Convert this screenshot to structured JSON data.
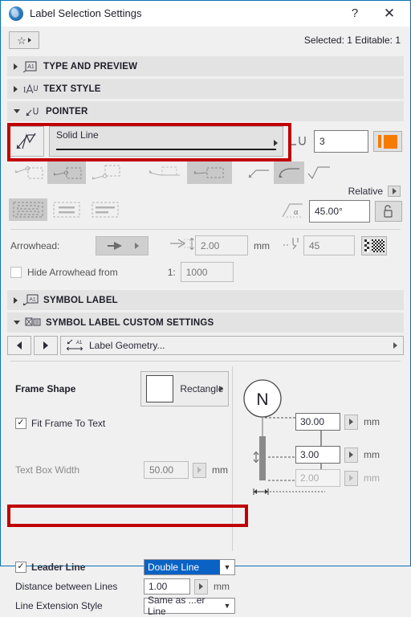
{
  "window": {
    "title": "Label Selection Settings",
    "icon": "archicad-orb-icon",
    "help_label": "?",
    "close_label": "✕"
  },
  "toolbar": {
    "favorites_icon": "star-icon",
    "selection_info": "Selected: 1 Editable: 1"
  },
  "panels": [
    {
      "id": "type-and-preview",
      "title": "TYPE AND PREVIEW",
      "expanded": false,
      "icon": "type-preview-icon"
    },
    {
      "id": "text-style",
      "title": "TEXT STYLE",
      "expanded": false,
      "icon": "text-style-icon"
    },
    {
      "id": "pointer",
      "title": "POINTER",
      "expanded": true,
      "icon": "pointer-icon"
    },
    {
      "id": "symbol-label",
      "title": "SYMBOL LABEL",
      "expanded": false,
      "icon": "symbol-label-icon"
    },
    {
      "id": "symbol-label-custom-settings",
      "title": "SYMBOL LABEL CUSTOM SETTINGS",
      "expanded": true,
      "icon": "custom-settings-icon"
    }
  ],
  "pointer": {
    "linetype_button_icon": "line-check-icon",
    "linetype_value": "Solid Line",
    "pen_icon": "pen-weight-icon",
    "pen_value": "3",
    "pen_color": "#f57c00",
    "pen_color_swatch": "orange-swatch",
    "anchor_icons": [
      {
        "name": "pointer-anchor-top-left",
        "selected": false
      },
      {
        "name": "pointer-anchor-middle-left",
        "selected": true
      },
      {
        "name": "pointer-anchor-bottom-left",
        "selected": false
      },
      {
        "name": "pointer-anchor-underline-left",
        "selected": false
      },
      {
        "name": "pointer-anchor-box-left",
        "selected": true
      }
    ],
    "shape_icons": [
      {
        "name": "pointer-shape-straight",
        "selected": false
      },
      {
        "name": "pointer-shape-curved",
        "selected": true
      },
      {
        "name": "pointer-shape-radical",
        "selected": false
      }
    ],
    "align_icons": [
      {
        "name": "text-align-fit",
        "selected": true
      },
      {
        "name": "text-align-center",
        "selected": false
      },
      {
        "name": "text-align-left",
        "selected": false
      }
    ],
    "relative_label": "Relative",
    "angle_icon": "angle-alpha-icon",
    "angle_value": "45.00°",
    "lock_icon": "lock-icon"
  },
  "arrowhead": {
    "label": "Arrowhead:",
    "type_icon": "arrowhead-solid-icon",
    "size_value": "2.00",
    "size_unit": "mm",
    "pen_icon": "arrowhead-pen-icon",
    "pen_value": "45",
    "pattern_icon": "checker-swatch",
    "hide_label": "Hide Arrowhead from",
    "hide_checked": false,
    "ratio_label": "1:",
    "ratio_value": "1000"
  },
  "custom_settings": {
    "prev_icon": "prev-arrow-icon",
    "next_icon": "next-arrow-icon",
    "page_icon": "label-geometry-icon",
    "page_label": "Label Geometry...",
    "expand_icon": "chevron-right-icon"
  },
  "frame": {
    "shape_label": "Frame Shape",
    "shape_value": "Rectangle",
    "fit_label": "Fit Frame To Text",
    "fit_checked": true,
    "textbox_label": "Text Box Width",
    "textbox_value": "50.00",
    "textbox_unit": "mm",
    "textbox_disabled": true
  },
  "preview": {
    "symbol_text": "N",
    "dim_top_value": "30.00",
    "dim_top_unit": "mm",
    "dim_mid_value": "3.00",
    "dim_mid_unit": "mm",
    "dim_bot_value": "2.00",
    "dim_bot_unit": "mm",
    "dim_bot_disabled": true
  },
  "leader": {
    "leader_label": "Leader Line",
    "leader_checked": true,
    "leader_value": "Double Line",
    "distance_label": "Distance between Lines",
    "distance_value": "1.00",
    "distance_unit": "mm",
    "extension_label": "Line Extension Style",
    "extension_value": "Same as ...er Line"
  },
  "colors": {
    "highlight_red": "#c00000",
    "accent_blue": "#0a63c4",
    "panel_bg": "#f0f0f0",
    "header_bg": "#e3e3e3"
  }
}
